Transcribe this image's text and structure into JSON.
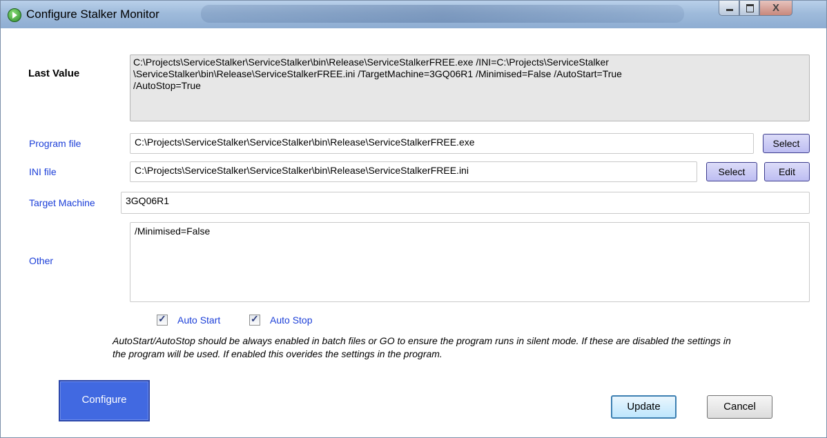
{
  "window": {
    "title": "Configure Stalker Monitor",
    "close_glyph": "X"
  },
  "last_value": {
    "label": "Last Value",
    "text": "C:\\Projects\\ServiceStalker\\ServiceStalker\\bin\\Release\\ServiceStalkerFREE.exe /INI=C:\\Projects\\ServiceStalker\n\\ServiceStalker\\bin\\Release\\ServiceStalkerFREE.ini /TargetMachine=3GQ06R1 /Minimised=False /AutoStart=True\n/AutoStop=True"
  },
  "program_file": {
    "label": "Program file",
    "value": "C:\\Projects\\ServiceStalker\\ServiceStalker\\bin\\Release\\ServiceStalkerFREE.exe",
    "select_label": "Select"
  },
  "ini_file": {
    "label": "INI file",
    "value": "C:\\Projects\\ServiceStalker\\ServiceStalker\\bin\\Release\\ServiceStalkerFREE.ini",
    "select_label": "Select",
    "edit_label": "Edit"
  },
  "target_machine": {
    "label": "Target Machine",
    "value": "3GQ06R1"
  },
  "other": {
    "label": "Other",
    "value": "/Minimised=False"
  },
  "options": {
    "auto_start": {
      "label": "Auto Start",
      "checked": true
    },
    "auto_stop": {
      "label": "Auto Stop",
      "checked": true
    }
  },
  "note": "AutoStart/AutoStop should be always enabled in batch files or GO to ensure the program runs in silent mode. If these are disabled the settings in the program will be used. If enabled this overides the settings in the program.",
  "buttons": {
    "configure": "Configure",
    "update": "Update",
    "cancel": "Cancel"
  },
  "colors": {
    "label_blue": "#1c3fd8",
    "configure_bg": "#4169e1"
  }
}
